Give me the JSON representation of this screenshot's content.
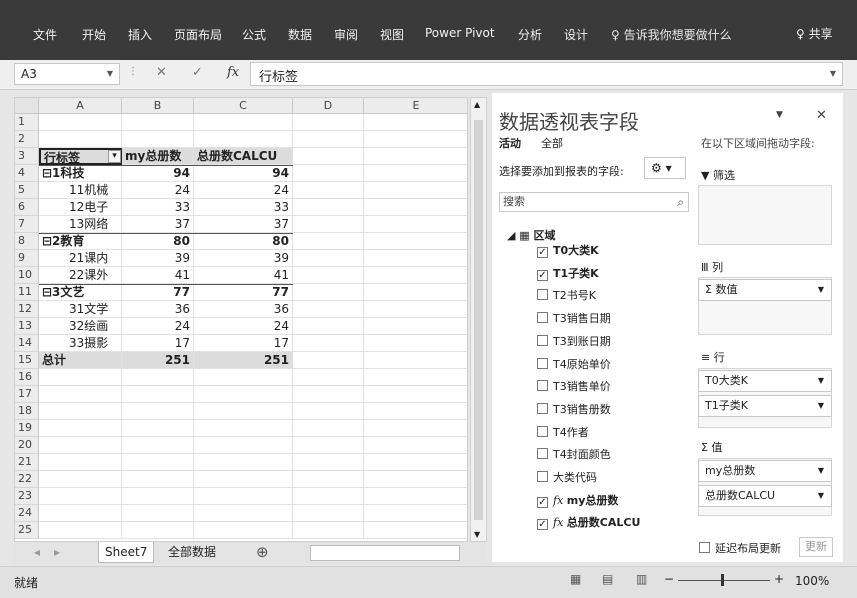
{
  "ribbon": {
    "tabs": [
      "文件",
      "开始",
      "插入",
      "页面布局",
      "公式",
      "数据",
      "审阅",
      "视图",
      "Power Pivot",
      "分析",
      "设计"
    ],
    "tell_me": "告诉我你想要做什么",
    "share": "共享"
  },
  "formula_bar": {
    "name_box": "A3",
    "cancel": "✕",
    "enter": "✓",
    "fx": "fx",
    "content": "行标签"
  },
  "sheet": {
    "columns": [
      "A",
      "B",
      "C",
      "D",
      "E"
    ],
    "rows": [
      "1",
      "2",
      "3",
      "4",
      "5",
      "6",
      "7",
      "8",
      "9",
      "10",
      "11",
      "12",
      "13",
      "14",
      "15",
      "16",
      "17",
      "18",
      "19",
      "20",
      "21",
      "22",
      "23",
      "24",
      "25"
    ],
    "pivot": {
      "headers": [
        "行标签",
        "my总册数",
        "总册数CALCU"
      ],
      "body": [
        {
          "label": "⊟1科技",
          "b": "94",
          "c": "94",
          "group": true
        },
        {
          "label": "11机械",
          "b": "24",
          "c": "24",
          "group": false
        },
        {
          "label": "12电子",
          "b": "33",
          "c": "33",
          "group": false
        },
        {
          "label": "13网络",
          "b": "37",
          "c": "37",
          "group": false
        },
        {
          "label": "⊟2教育",
          "b": "80",
          "c": "80",
          "group": true
        },
        {
          "label": "21课内",
          "b": "39",
          "c": "39",
          "group": false
        },
        {
          "label": "22课外",
          "b": "41",
          "c": "41",
          "group": false
        },
        {
          "label": "⊟3文艺",
          "b": "77",
          "c": "77",
          "group": true
        },
        {
          "label": "31文学",
          "b": "36",
          "c": "36",
          "group": false
        },
        {
          "label": "32绘画",
          "b": "24",
          "c": "24",
          "group": false
        },
        {
          "label": "33摄影",
          "b": "17",
          "c": "17",
          "group": false
        }
      ],
      "total": {
        "label": "总计",
        "b": "251",
        "c": "251"
      }
    }
  },
  "sheet_tabs": {
    "active": "Sheet7",
    "other": "全部数据",
    "add": "⊕"
  },
  "status": {
    "ready": "就绪",
    "zoom": "100%"
  },
  "pivot_pane": {
    "title": "数据透视表字段",
    "close": "✕",
    "tab_active": "活动",
    "tab_all": "全部",
    "choose_label": "选择要添加到报表的字段:",
    "drag_label": "在以下区域间拖动字段:",
    "search_placeholder": "搜索",
    "table_name": "区域",
    "fields": [
      {
        "name": "T0大类K",
        "checked": true,
        "bold": true,
        "calc": false
      },
      {
        "name": "T1子类K",
        "checked": true,
        "bold": true,
        "calc": false
      },
      {
        "name": "T2书号K",
        "checked": false,
        "bold": false,
        "calc": false
      },
      {
        "name": "T3销售日期",
        "checked": false,
        "bold": false,
        "calc": false
      },
      {
        "name": "T3到账日期",
        "checked": false,
        "bold": false,
        "calc": false
      },
      {
        "name": "T4原始单价",
        "checked": false,
        "bold": false,
        "calc": false
      },
      {
        "name": "T3销售单价",
        "checked": false,
        "bold": false,
        "calc": false
      },
      {
        "name": "T3销售册数",
        "checked": false,
        "bold": false,
        "calc": false
      },
      {
        "name": "T4作者",
        "checked": false,
        "bold": false,
        "calc": false
      },
      {
        "name": "T4封面颜色",
        "checked": false,
        "bold": false,
        "calc": false
      },
      {
        "name": "大类代码",
        "checked": false,
        "bold": false,
        "calc": false
      },
      {
        "name": "my总册数",
        "checked": true,
        "bold": true,
        "calc": true
      },
      {
        "name": "总册数CALCU",
        "checked": true,
        "bold": true,
        "calc": true
      }
    ],
    "areas": {
      "filter": "筛选",
      "columns": "列",
      "columns_items": [
        "Σ 数值"
      ],
      "rows": "行",
      "rows_items": [
        "T0大类K",
        "T1子类K"
      ],
      "values": "值",
      "values_items": [
        "my总册数",
        "总册数CALCU"
      ]
    },
    "defer_label": "延迟布局更新",
    "update_label": "更新"
  }
}
